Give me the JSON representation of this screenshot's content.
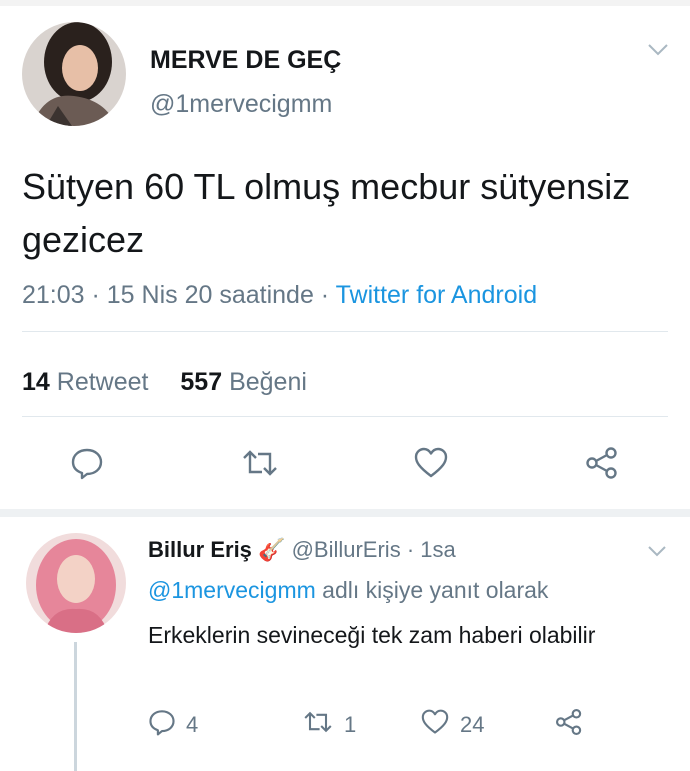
{
  "tweet": {
    "display_name": "MERVE DE GEÇ",
    "handle": "@1mervecigmm",
    "text": "Sütyen 60 TL olmuş mecbur sütyensiz gezicez",
    "time": "21:03 · 15 Nis 20 saatinde · ",
    "source": "Twitter for Android",
    "retweet_count": "14",
    "retweet_label": "Retweet",
    "like_count": "557",
    "like_label": "Beğeni",
    "icons": [
      "chevron-down-icon",
      "reply-icon",
      "retweet-icon",
      "heart-icon",
      "share-icon"
    ]
  },
  "reply": {
    "display_name": "Billur Eriş",
    "handle": "@BillurEris",
    "time": " · 1sa",
    "reply_to_handle": "@1mervecigmm",
    "reply_to_suffix": " adlı kişiye yanıt olarak",
    "text": "Erkeklerin sevineceği tek zam haberi olabilir",
    "reply_count": "4",
    "retweet_count": "1",
    "like_count": "24",
    "icons": [
      "guitar-icon",
      "chevron-down-icon",
      "reply-icon",
      "retweet-icon",
      "heart-icon",
      "share-icon"
    ]
  },
  "colors": {
    "text": "#14171a",
    "secondary": "#657786",
    "link": "#1b95e0",
    "divider": "#e1e8ed"
  }
}
